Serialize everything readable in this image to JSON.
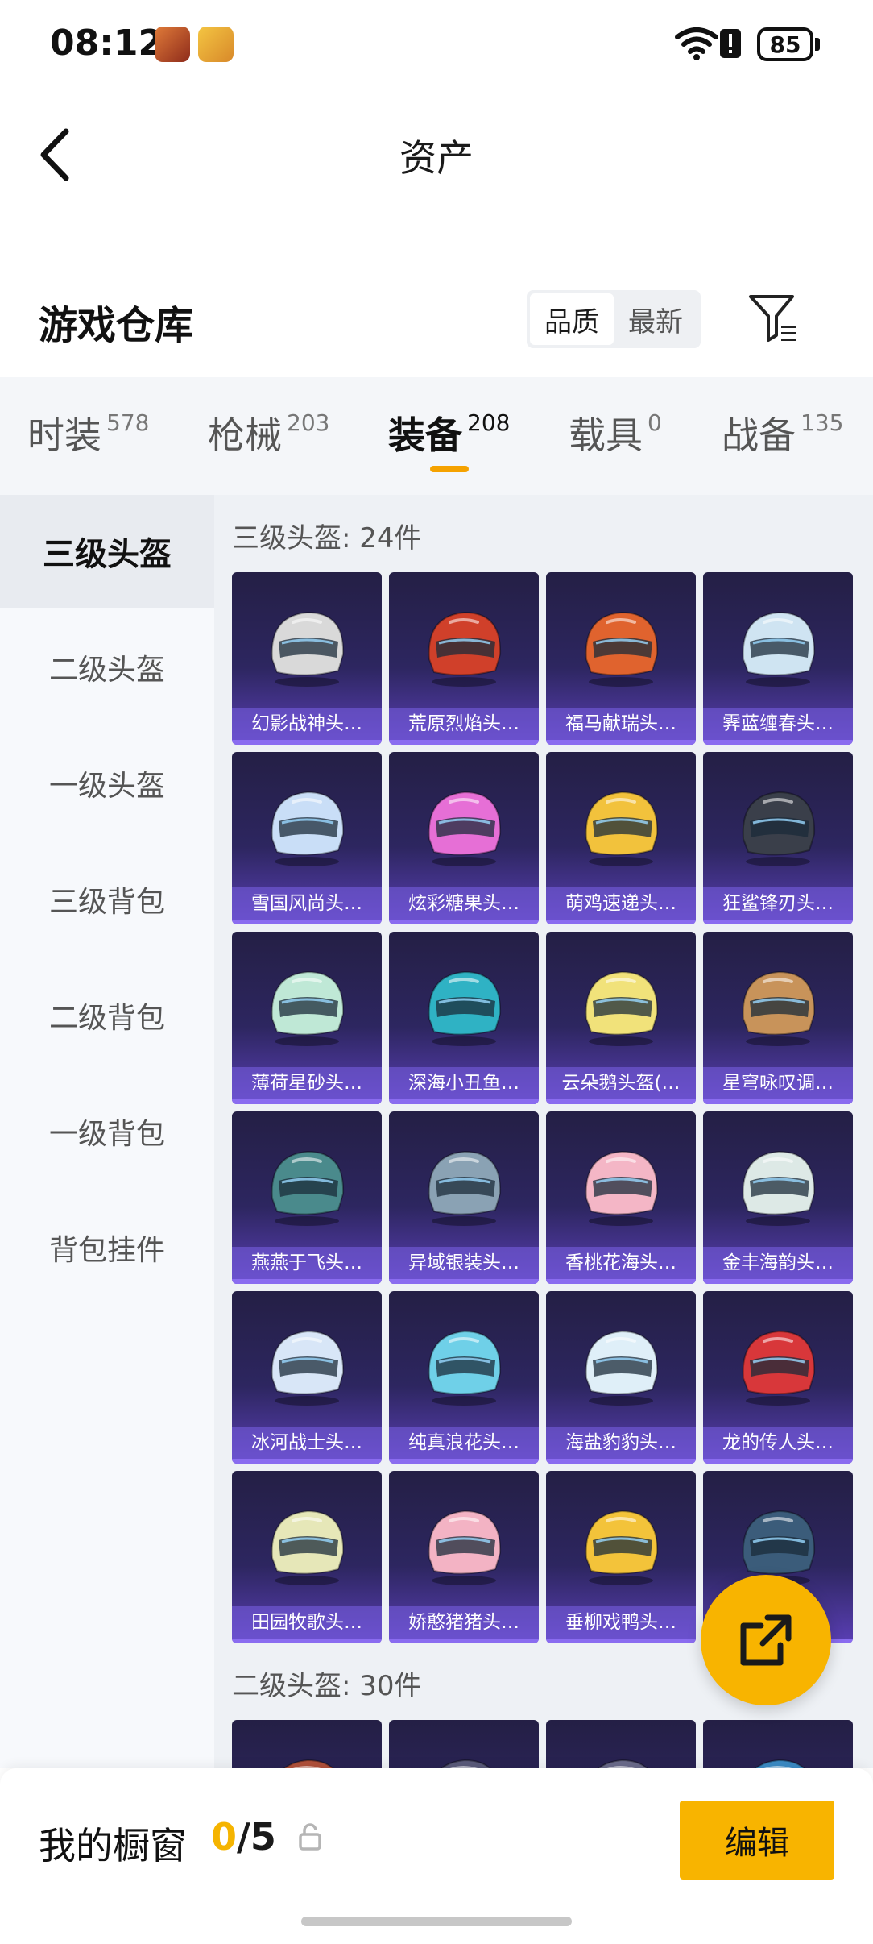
{
  "status_bar": {
    "time": "08:12",
    "battery": "85"
  },
  "header": {
    "title": "资产"
  },
  "warehouse": {
    "title": "游戏仓库",
    "sort_options": [
      "品质",
      "最新"
    ],
    "sort_selected": "品质"
  },
  "categories": [
    {
      "label": "时装",
      "count": "578"
    },
    {
      "label": "枪械",
      "count": "203"
    },
    {
      "label": "装备",
      "count": "208",
      "active": true
    },
    {
      "label": "载具",
      "count": "0"
    },
    {
      "label": "战备",
      "count": "135"
    }
  ],
  "sidebar": {
    "items": [
      "三级头盔",
      "二级头盔",
      "一级头盔",
      "三级背包",
      "二级背包",
      "一级背包",
      "背包挂件"
    ],
    "active_index": 0
  },
  "groups": [
    {
      "title": "三级头盔: 24件",
      "items": [
        {
          "name": "幻影战神头…",
          "color": "#d9d9d9"
        },
        {
          "name": "荒原烈焰头…",
          "color": "#d0402a"
        },
        {
          "name": "福马献瑞头…",
          "color": "#e0632e"
        },
        {
          "name": "霁蓝缠春头…",
          "color": "#cfe4f2"
        },
        {
          "name": "雪国风尚头…",
          "color": "#c9def7"
        },
        {
          "name": "炫彩糖果头…",
          "color": "#e66fd6"
        },
        {
          "name": "萌鸡速递头…",
          "color": "#f2c23c"
        },
        {
          "name": "狂鲨锋刃头…",
          "color": "#3a3f4a"
        },
        {
          "name": "薄荷星砂头…",
          "color": "#bfe8d6"
        },
        {
          "name": "深海小丑鱼…",
          "color": "#2fb2c4"
        },
        {
          "name": "云朵鹅头盔(…",
          "color": "#f1e27a"
        },
        {
          "name": "星穹咏叹调…",
          "color": "#c8935a"
        },
        {
          "name": "燕燕于飞头…",
          "color": "#4a8a8c"
        },
        {
          "name": "异域银装头…",
          "color": "#8aa2b4"
        },
        {
          "name": "香桃花海头…",
          "color": "#f4b6c6"
        },
        {
          "name": "金丰海韵头…",
          "color": "#dde9e6"
        },
        {
          "name": "冰河战士头…",
          "color": "#d8e6f7"
        },
        {
          "name": "纯真浪花头…",
          "color": "#6fd0e8"
        },
        {
          "name": "海盐豹豹头…",
          "color": "#dfeff8"
        },
        {
          "name": "龙的传人头…",
          "color": "#d8373a"
        },
        {
          "name": "田园牧歌头…",
          "color": "#e6e7b8"
        },
        {
          "name": "娇憨猪猪头…",
          "color": "#f3b3c4"
        },
        {
          "name": "垂柳戏鸭头…",
          "color": "#f3c33a"
        },
        {
          "name": "",
          "color": "#3b5c7a"
        }
      ]
    },
    {
      "title": "二级头盔: 30件",
      "items": [
        {
          "name": "",
          "color": "#b0503a"
        },
        {
          "name": "",
          "color": "#5a5a7a"
        },
        {
          "name": "",
          "color": "#6a6a8a"
        },
        {
          "name": "",
          "color": "#3a8ac4"
        }
      ]
    }
  ],
  "showcase": {
    "label": "我的橱窗",
    "current": "0",
    "total": "/5",
    "edit_label": "编辑"
  }
}
